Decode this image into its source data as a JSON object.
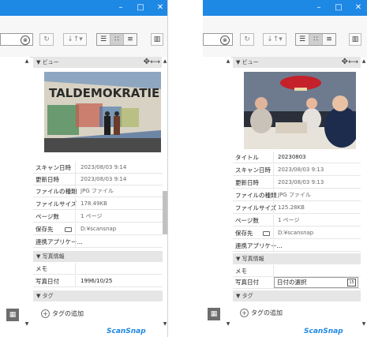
{
  "brand": "ScanSnap",
  "window": {
    "minimize": "–",
    "maximize": "□",
    "close": "✕"
  },
  "toolbar": {
    "clear": "⊗",
    "refresh": "↻",
    "sort": "↓↑▾",
    "view_list": "☰",
    "view_thumb": "∷",
    "view_detail": "≡",
    "layout": "▥"
  },
  "left": {
    "preview_section": "▼ ビュー",
    "rows": [
      {
        "key": "スキャン日時",
        "value": "2023/08/03 9:14"
      },
      {
        "key": "更新日時",
        "value": "2023/08/03 9:14"
      },
      {
        "key": "ファイルの種類",
        "value": "JPG ファイル"
      },
      {
        "key": "ファイルサイズ",
        "value": "178.49KB"
      },
      {
        "key": "ページ数",
        "value": "1 ページ"
      },
      {
        "key": "保存先",
        "value": "D:¥scansnap"
      },
      {
        "key": "連携アプリケー...",
        "value": ""
      }
    ],
    "photo_section": "▼ 写真情報",
    "photo_rows": [
      {
        "key": "メモ",
        "value": ""
      },
      {
        "key": "写真日付",
        "value": "1996/10/25"
      }
    ],
    "tag_section": "▼ タグ",
    "add_tag": "タグの追加"
  },
  "right": {
    "preview_section": "▼ ビュー",
    "rows": [
      {
        "key": "タイトル",
        "value": "20230803"
      },
      {
        "key": "スキャン日時",
        "value": "2023/08/03 9:13"
      },
      {
        "key": "更新日時",
        "value": "2023/08/03 9:13"
      },
      {
        "key": "ファイルの種類",
        "value": "JPG ファイル"
      },
      {
        "key": "ファイルサイズ",
        "value": "125.28KB"
      },
      {
        "key": "ページ数",
        "value": "1 ページ"
      },
      {
        "key": "保存先",
        "value": "D:¥scansnap"
      },
      {
        "key": "連携アプリケー...",
        "value": ""
      }
    ],
    "photo_section": "▼ 写真情報",
    "photo_rows": [
      {
        "key": "メモ",
        "value": ""
      },
      {
        "key": "写真日付",
        "value": "日付の選択"
      }
    ],
    "tag_section": "▼ タグ",
    "add_tag": "タグの追加",
    "calendar_label": "15"
  }
}
